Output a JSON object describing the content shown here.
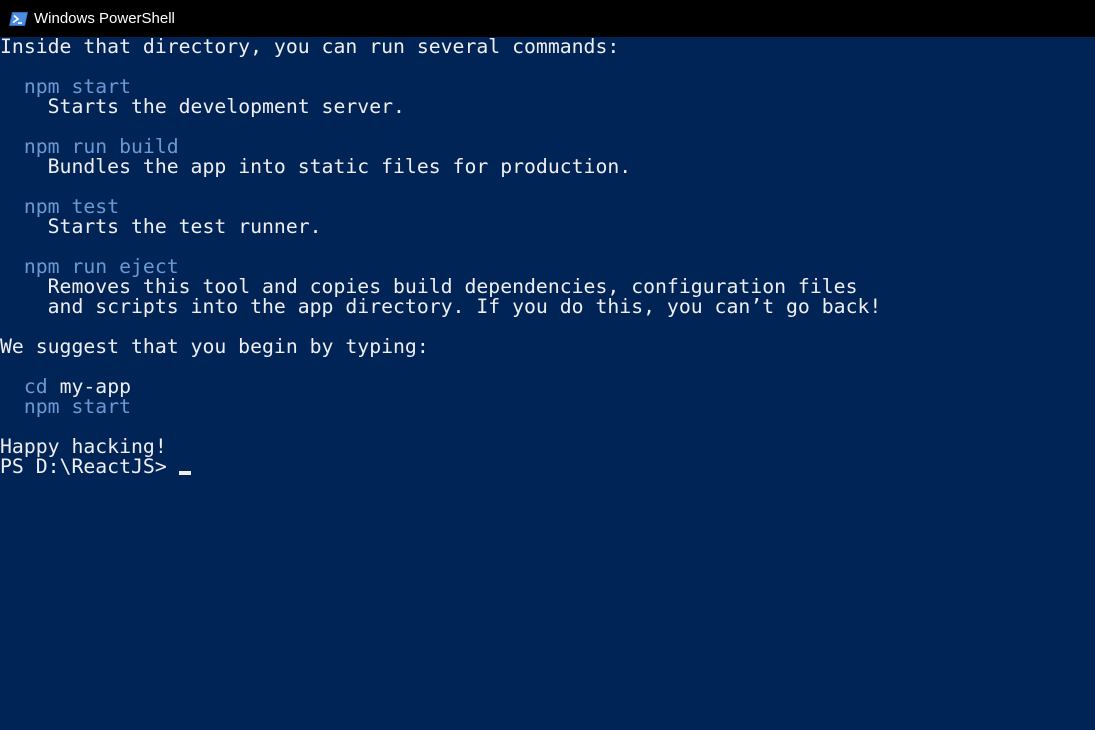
{
  "window": {
    "title": "Windows PowerShell",
    "icon": "powershell-icon"
  },
  "console": {
    "intro": "Inside that directory, you can run several commands:",
    "commands": [
      {
        "command": "npm start",
        "description": [
          "Starts the development server."
        ]
      },
      {
        "command": "npm run build",
        "description": [
          "Bundles the app into static files for production."
        ]
      },
      {
        "command": "npm test",
        "description": [
          "Starts the test runner."
        ]
      },
      {
        "command": "npm run eject",
        "description": [
          "Removes this tool and copies build dependencies, configuration files",
          "and scripts into the app directory. If you do this, you can’t go back!"
        ]
      }
    ],
    "suggest": "We suggest that you begin by typing:",
    "suggest_cd": "cd",
    "suggest_cd_arg": " my-app",
    "suggest_start": "npm start",
    "farewell": "Happy hacking!",
    "prompt": "PS D:\\ReactJS> "
  },
  "colors": {
    "background": "#012456",
    "titlebar": "#000000",
    "text": "#eeedf0",
    "command": "#6a98d4"
  }
}
